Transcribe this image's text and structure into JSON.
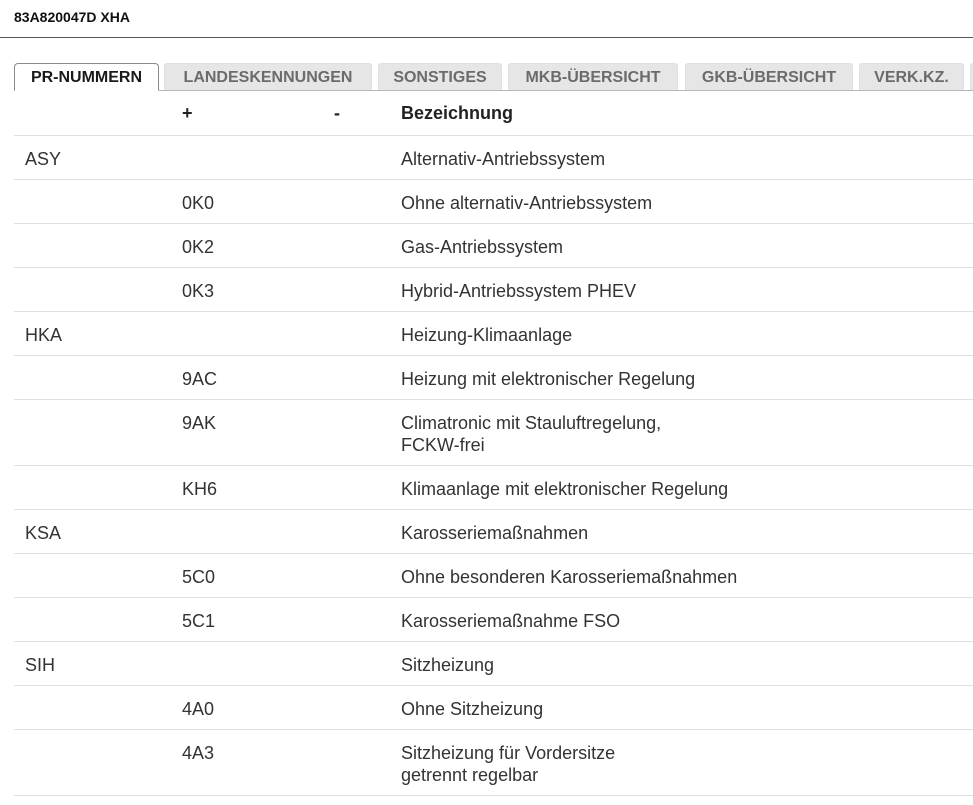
{
  "document": {
    "title": "83A820047D XHA"
  },
  "tabs": [
    {
      "label": "PR-NUMMERN",
      "active": true
    },
    {
      "label": "LANDESKENNUNGEN",
      "active": false
    },
    {
      "label": "SONSTIGES",
      "active": false
    },
    {
      "label": "MKB-ÜBERSICHT",
      "active": false
    },
    {
      "label": "GKB-ÜBERSICHT",
      "active": false
    },
    {
      "label": "VERK.KZ.",
      "active": false
    }
  ],
  "table": {
    "columns": {
      "group": "",
      "plus": "+",
      "minus": "-",
      "description": "Bezeichnung"
    },
    "rows": [
      {
        "group": "ASY",
        "plus": "",
        "minus": "",
        "description": [
          "Alternativ-Antriebssystem"
        ]
      },
      {
        "group": "",
        "plus": "0K0",
        "minus": "",
        "description": [
          "Ohne alternativ-Antriebssystem"
        ]
      },
      {
        "group": "",
        "plus": "0K2",
        "minus": "",
        "description": [
          "Gas-Antriebssystem"
        ]
      },
      {
        "group": "",
        "plus": "0K3",
        "minus": "",
        "description": [
          "Hybrid-Antriebssystem PHEV"
        ]
      },
      {
        "group": "HKA",
        "plus": "",
        "minus": "",
        "description": [
          "Heizung-Klimaanlage"
        ]
      },
      {
        "group": "",
        "plus": "9AC",
        "minus": "",
        "description": [
          "Heizung mit elektronischer Regelung"
        ]
      },
      {
        "group": "",
        "plus": "9AK",
        "minus": "",
        "description": [
          "Climatronic mit Stauluftregelung,",
          "FCKW-frei"
        ]
      },
      {
        "group": "",
        "plus": "KH6",
        "minus": "",
        "description": [
          "Klimaanlage mit elektronischer Regelung"
        ]
      },
      {
        "group": "KSA",
        "plus": "",
        "minus": "",
        "description": [
          "Karosseriemaßnahmen"
        ]
      },
      {
        "group": "",
        "plus": "5C0",
        "minus": "",
        "description": [
          "Ohne besonderen Karosseriemaßnahmen"
        ]
      },
      {
        "group": "",
        "plus": "5C1",
        "minus": "",
        "description": [
          "Karosseriemaßnahme FSO"
        ]
      },
      {
        "group": "SIH",
        "plus": "",
        "minus": "",
        "description": [
          "Sitzheizung"
        ]
      },
      {
        "group": "",
        "plus": "4A0",
        "minus": "",
        "description": [
          "Ohne Sitzheizung"
        ]
      },
      {
        "group": "",
        "plus": "4A3",
        "minus": "",
        "description": [
          "Sitzheizung für Vordersitze",
          "getrennt regelbar"
        ]
      }
    ]
  }
}
